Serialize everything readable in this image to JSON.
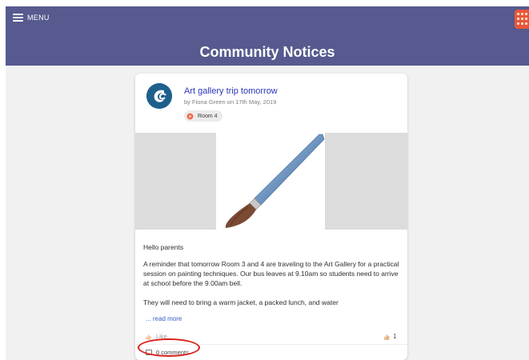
{
  "header": {
    "menu_label": "MENU",
    "title": "Community Notices",
    "color": "#565a8e"
  },
  "post": {
    "title": "Art gallery trip tomorrow",
    "byline": "by Fiona Green on 17th May, 2019",
    "tag": "Room 4",
    "image_icon": "paintbrush-icon",
    "greeting": "Hello parents",
    "paragraph1": "A reminder that tomorrow Room 3 and 4 are traveling to the Art Gallery for a practical session on painting techniques. Our bus leaves at 9.10am so students need to arrive at school before the 9.00am bell.",
    "paragraph2": "They will need to bring a warm jacket, a packed lunch, and water",
    "read_more": "... read more",
    "like_label": "Like",
    "like_count": "1",
    "comments_label": "0 comments"
  },
  "annotation": {
    "highlight_color": "#d9201a"
  }
}
